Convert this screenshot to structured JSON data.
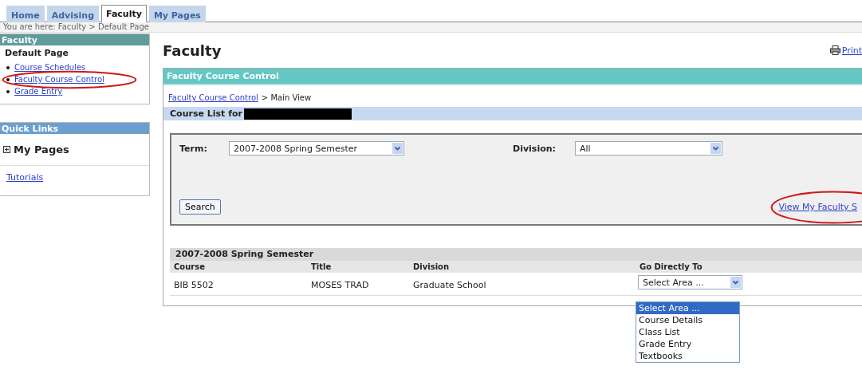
{
  "tabs": [
    {
      "label": "Home",
      "selected": false
    },
    {
      "label": "Advising",
      "selected": false
    },
    {
      "label": "Faculty",
      "selected": true
    },
    {
      "label": "My Pages",
      "selected": false
    }
  ],
  "breadcrumb": "You are here:  Faculty > Default Page",
  "sidebar": {
    "title": "Faculty",
    "subtitle": "Default Page",
    "links": [
      {
        "label": "Course Schedules",
        "circled": false
      },
      {
        "label": "Faculty Course Control",
        "circled": true
      },
      {
        "label": "Grade Entry",
        "circled": false
      }
    ],
    "quick_links": {
      "title": "Quick Links",
      "group": {
        "label": "My Pages",
        "expanded": false
      },
      "links": [
        "Tutorials"
      ]
    }
  },
  "main": {
    "title": "Faculty",
    "print_link": "Print",
    "panel": {
      "title": "Faculty Course Control",
      "path_link": "Faculty Course Control",
      "path_rest": "> Main View",
      "list_title": "Course List for",
      "filters": {
        "term_label": "Term:",
        "term_value": "2007-2008 Spring Semester",
        "division_label": "Division:",
        "division_value": "All",
        "search_button": "Search",
        "view_link": {
          "label": "View My Faculty S",
          "circled": true
        }
      },
      "results": {
        "heading": "2007-2008 Spring Semester",
        "columns": [
          "Course",
          "Title",
          "Division",
          "Go Directly To"
        ],
        "rows": [
          {
            "course": "BIB 5502",
            "title": "MOSES TRAD",
            "division": "Graduate School",
            "go_to": {
              "value": "Select Area ...",
              "open": true,
              "options": [
                {
                  "label": "Select Area ...",
                  "selected": true
                },
                {
                  "label": "Course Details",
                  "selected": false
                },
                {
                  "label": "Class List",
                  "selected": false
                },
                {
                  "label": "Grade Entry",
                  "selected": false
                },
                {
                  "label": "Textbooks",
                  "selected": false
                }
              ]
            }
          }
        ]
      }
    }
  }
}
